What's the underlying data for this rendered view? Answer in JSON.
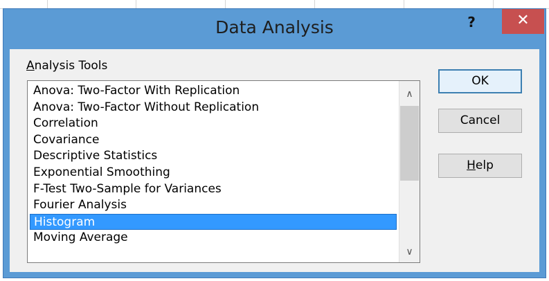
{
  "dialog": {
    "title": "Data Analysis",
    "help_glyph": "?",
    "close_glyph": "✕"
  },
  "analysis_tools": {
    "label_accel": "A",
    "label_rest": "nalysis Tools",
    "items": [
      {
        "label": "Anova: Two-Factor With Replication"
      },
      {
        "label": "Anova: Two-Factor Without Replication"
      },
      {
        "label": "Correlation"
      },
      {
        "label": "Covariance"
      },
      {
        "label": "Descriptive Statistics"
      },
      {
        "label": "Exponential Smoothing"
      },
      {
        "label": "F-Test Two-Sample for Variances"
      },
      {
        "label": "Fourier Analysis"
      },
      {
        "label": "Histogram"
      },
      {
        "label": "Moving Average"
      }
    ],
    "selected": "Histogram"
  },
  "scrollbar": {
    "up_glyph": "∧",
    "down_glyph": "∨"
  },
  "buttons": {
    "ok": "OK",
    "cancel": "Cancel",
    "help_accel": "H",
    "help_rest": "elp"
  },
  "colors": {
    "title_bar": "#5b9bd5",
    "close_button": "#c75050",
    "selection": "#3399ff"
  }
}
